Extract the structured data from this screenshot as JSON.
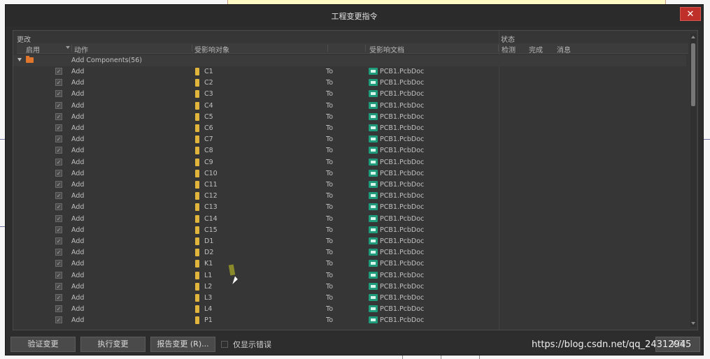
{
  "dialog": {
    "title": "工程变更指令",
    "close_glyph": "✕"
  },
  "groups": {
    "changes": "更改",
    "status": "状态"
  },
  "columns": {
    "enable": "启用",
    "action": "动作",
    "affected_object": "受影响对象",
    "affected_document": "受影响文档",
    "check": "检测",
    "done": "完成",
    "message": "消息"
  },
  "group_row": {
    "label": "Add Components(56)"
  },
  "rows": [
    {
      "action": "Add",
      "object": "C1",
      "to": "To",
      "document": "PCB1.PcbDoc"
    },
    {
      "action": "Add",
      "object": "C2",
      "to": "To",
      "document": "PCB1.PcbDoc"
    },
    {
      "action": "Add",
      "object": "C3",
      "to": "To",
      "document": "PCB1.PcbDoc"
    },
    {
      "action": "Add",
      "object": "C4",
      "to": "To",
      "document": "PCB1.PcbDoc"
    },
    {
      "action": "Add",
      "object": "C5",
      "to": "To",
      "document": "PCB1.PcbDoc"
    },
    {
      "action": "Add",
      "object": "C6",
      "to": "To",
      "document": "PCB1.PcbDoc"
    },
    {
      "action": "Add",
      "object": "C7",
      "to": "To",
      "document": "PCB1.PcbDoc"
    },
    {
      "action": "Add",
      "object": "C8",
      "to": "To",
      "document": "PCB1.PcbDoc"
    },
    {
      "action": "Add",
      "object": "C9",
      "to": "To",
      "document": "PCB1.PcbDoc"
    },
    {
      "action": "Add",
      "object": "C10",
      "to": "To",
      "document": "PCB1.PcbDoc"
    },
    {
      "action": "Add",
      "object": "C11",
      "to": "To",
      "document": "PCB1.PcbDoc"
    },
    {
      "action": "Add",
      "object": "C12",
      "to": "To",
      "document": "PCB1.PcbDoc"
    },
    {
      "action": "Add",
      "object": "C13",
      "to": "To",
      "document": "PCB1.PcbDoc"
    },
    {
      "action": "Add",
      "object": "C14",
      "to": "To",
      "document": "PCB1.PcbDoc"
    },
    {
      "action": "Add",
      "object": "C15",
      "to": "To",
      "document": "PCB1.PcbDoc"
    },
    {
      "action": "Add",
      "object": "D1",
      "to": "To",
      "document": "PCB1.PcbDoc"
    },
    {
      "action": "Add",
      "object": "D2",
      "to": "To",
      "document": "PCB1.PcbDoc"
    },
    {
      "action": "Add",
      "object": "K1",
      "to": "To",
      "document": "PCB1.PcbDoc"
    },
    {
      "action": "Add",
      "object": "L1",
      "to": "To",
      "document": "PCB1.PcbDoc"
    },
    {
      "action": "Add",
      "object": "L2",
      "to": "To",
      "document": "PCB1.PcbDoc"
    },
    {
      "action": "Add",
      "object": "L3",
      "to": "To",
      "document": "PCB1.PcbDoc"
    },
    {
      "action": "Add",
      "object": "L4",
      "to": "To",
      "document": "PCB1.PcbDoc"
    },
    {
      "action": "Add",
      "object": "P1",
      "to": "To",
      "document": "PCB1.PcbDoc"
    }
  ],
  "buttons": {
    "validate": "验证变更",
    "execute": "执行变更",
    "report": "报告变更 (R)...",
    "close": "关闭"
  },
  "options": {
    "only_errors": "仅显示错误"
  },
  "watermark": "https://blog.csdn.net/qq_24312945",
  "icons": {
    "folder": "folder-icon",
    "component": "component-icon",
    "document": "pcb-document-icon"
  }
}
